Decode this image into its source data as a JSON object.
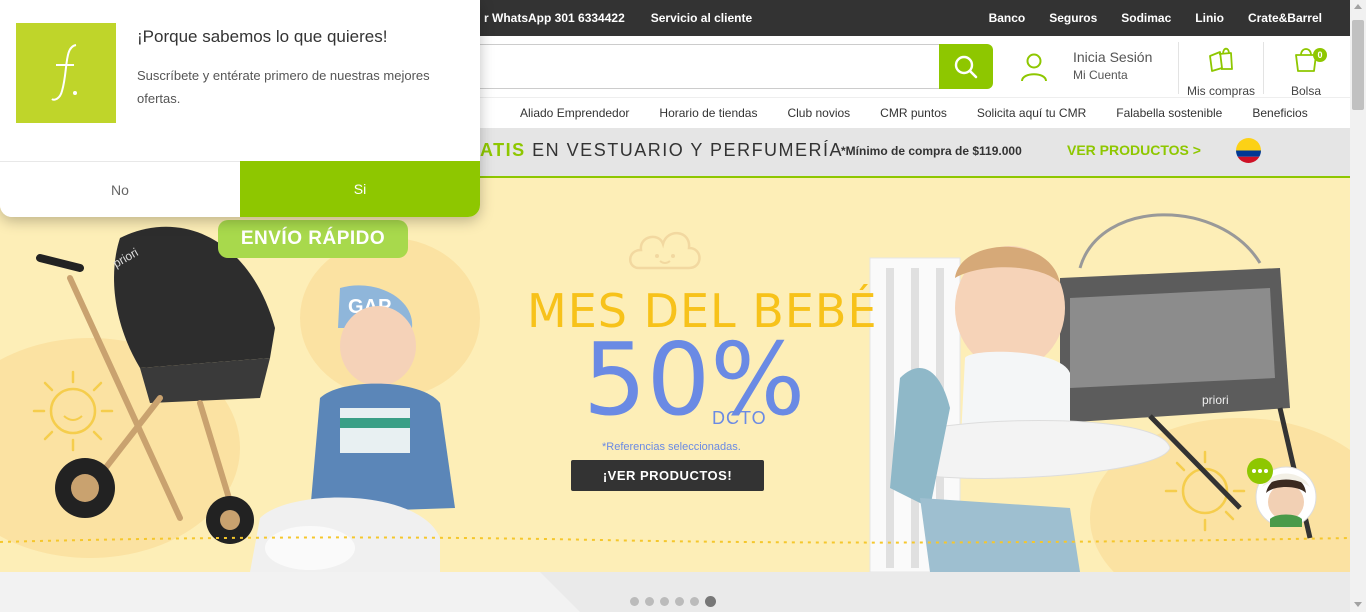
{
  "topbar": {
    "left_links": [
      "r WhatsApp 301 6334422",
      "Servicio al cliente"
    ],
    "right_links": [
      "Banco",
      "Seguros",
      "Sodimac",
      "Linio",
      "Crate&Barrel"
    ]
  },
  "header": {
    "search_placeholder": "",
    "session_line1": "Inicia Sesión",
    "session_line2": "Mi Cuenta",
    "purchases_label": "Mis compras",
    "cart_label": "Bolsa",
    "cart_count": "0"
  },
  "nav": {
    "items": [
      "Aliado Emprendedor",
      "Horario de tiendas",
      "Club novios",
      "CMR puntos",
      "Solicita aquí tu CMR",
      "Falabella sostenible",
      "Beneficios"
    ]
  },
  "promo": {
    "highlight": "ATIS",
    "text": " EN VESTUARIO Y PERFUMERÍA",
    "minimum": "*Mínimo de compra de $119.000",
    "cta": "VER PRODUCTOS >"
  },
  "hero": {
    "badge": "ENVÍO RÁPIDO",
    "title": "MES DEL BEBÉ",
    "percent": "50%",
    "dcto": "DCTO",
    "note": "*Referencias seleccionadas.",
    "cta": "¡VER PRODUCTOS!",
    "stroller_brand": "priori",
    "cap_text": "GAP",
    "crib_brand": "priori"
  },
  "carousel": {
    "count": 6,
    "active_index": 5
  },
  "popup": {
    "title": "¡Porque sabemos lo que quieres!",
    "message": "Suscríbete y entérate primero de nuestras mejores ofertas.",
    "no_label": "No",
    "yes_label": "Si",
    "logo_glyph": "f."
  },
  "colors": {
    "brand_green": "#8ec700",
    "topbar_bg": "#333333",
    "hero_bg": "#fdeeb7",
    "hero_title": "#f7c21a",
    "hero_percent": "#6a8ae4",
    "logo_bg": "#bfd52a"
  },
  "icons": [
    "search-icon",
    "user-icon",
    "shopping-bags-icon",
    "cart-bag-icon",
    "colombia-flag-icon",
    "chat-assistant-icon"
  ]
}
